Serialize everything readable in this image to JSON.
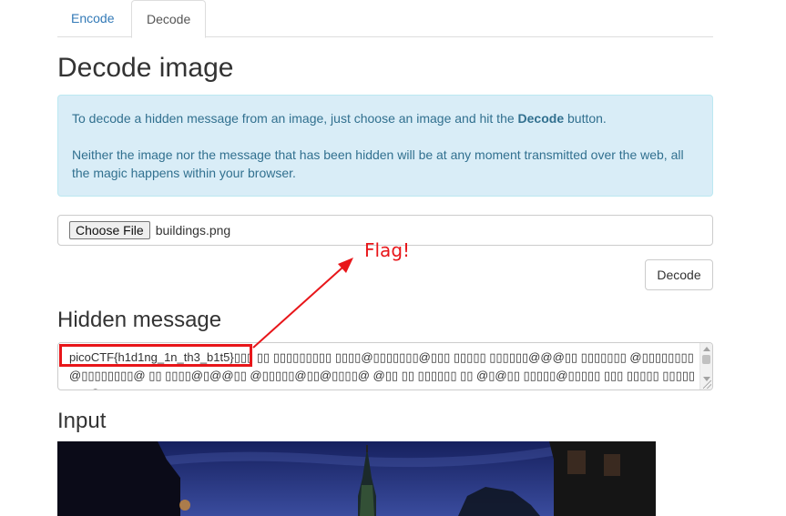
{
  "tabs": [
    {
      "label": "Encode",
      "active": false
    },
    {
      "label": "Decode",
      "active": true
    }
  ],
  "page_title": "Decode image",
  "info": {
    "line1_prefix": "To decode a hidden message from an image, just choose an image and hit the ",
    "line1_bold": "Decode",
    "line1_suffix": " button.",
    "line2": "Neither the image nor the message that has been hidden will be at any moment transmitted over the web, all the magic happens within your browser."
  },
  "file_input": {
    "button_label": "Choose File",
    "file_name": "buildings.png"
  },
  "decode_button_label": "Decode",
  "hidden_message": {
    "heading": "Hidden message",
    "flag": "picoCTF{h1d1ng_1n_th3_b1t5}",
    "garbage": "▯▯▯  ▯▯ ▯▯▯▯▯▯▯▯▯ ▯▯▯▯@▯▯▯▯▯▯▯@▯▯▯ ▯▯▯▯▯ ▯▯▯▯▯▯@@@▯▯ ▯▯▯▯▯▯▯ @▯▯▯▯▯▯▯▯@▯▯▯▯▯▯▯▯@ ▯▯  ▯▯▯▯@▯@@▯▯ @▯▯▯▯▯@▯▯@▯▯▯▯@ @▯▯ ▯▯ ▯▯▯▯▯▯ ▯▯ @▯@▯▯ ▯▯▯▯▯@▯▯▯▯▯ ▯▯▯ ▯▯▯▯▯ ▯▯▯▯▯▯▯▯@▯▯▯▯ ▯▯▯▯"
  },
  "annotation": {
    "label": "Flag!",
    "color": "#e8161a"
  },
  "input_heading": "Input"
}
